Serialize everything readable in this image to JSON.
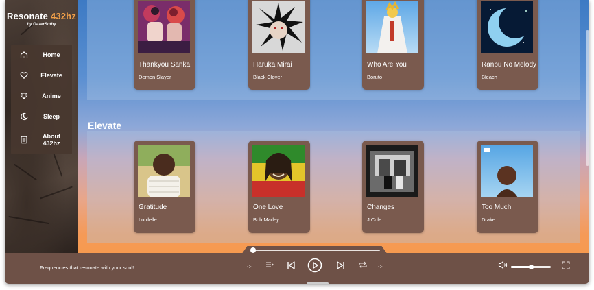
{
  "app": {
    "title_main": "Resonate ",
    "title_accent": "432hz",
    "byline": "by GazerSuthy",
    "accent_color": "#f1a04a"
  },
  "nav": {
    "items": [
      {
        "label": "Home",
        "icon": "home-icon"
      },
      {
        "label": "Elevate",
        "icon": "heart-icon"
      },
      {
        "label": "Anime",
        "icon": "diamond-icon"
      },
      {
        "label": "Sleep",
        "icon": "moon-hand-icon"
      },
      {
        "label": "About 432hz",
        "icon": "document-icon"
      }
    ]
  },
  "anime_section": {
    "cards": [
      {
        "title": "Thankyou Sanka",
        "artist": "Demon Slayer"
      },
      {
        "title": "Haruka Mirai",
        "artist": "Black Clover"
      },
      {
        "title": "Who Are You",
        "artist": "Boruto"
      },
      {
        "title": "Ranbu No Melody",
        "artist": "Bleach"
      }
    ]
  },
  "elevate_section": {
    "title": "Elevate",
    "cards": [
      {
        "title": "Gratitude",
        "artist": "Lordelle"
      },
      {
        "title": "One Love",
        "artist": "Bob Marley"
      },
      {
        "title": "Changes",
        "artist": "J Cole"
      },
      {
        "title": "Too Much",
        "artist": "Drake"
      }
    ]
  },
  "player": {
    "tagline": "Frequencies that resonate with your soul!",
    "time_elapsed": "-:-",
    "time_total": "-:-",
    "progress": 0.0,
    "volume": 0.5
  }
}
